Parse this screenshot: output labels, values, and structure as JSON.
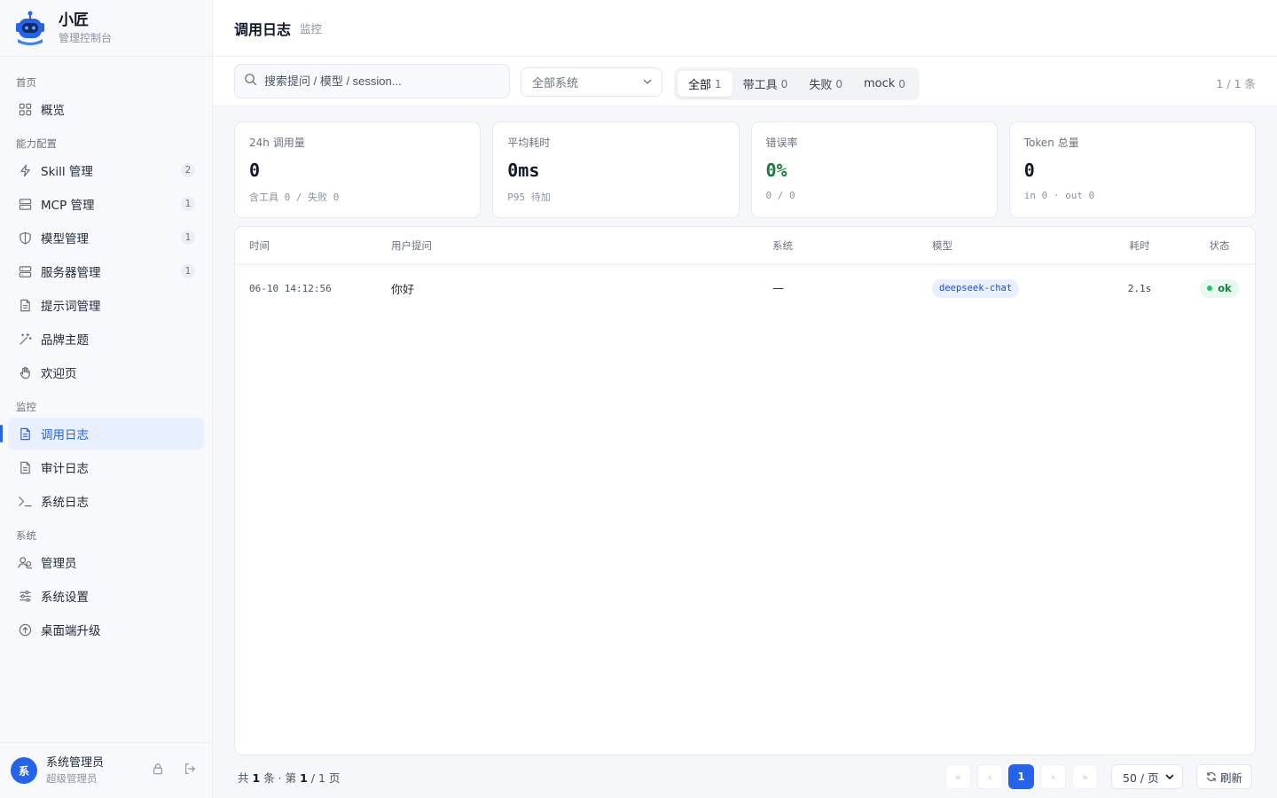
{
  "brand": {
    "title": "小匠",
    "subtitle": "管理控制台"
  },
  "nav": {
    "sections": [
      {
        "label": "首页"
      },
      {
        "label": "能力配置"
      },
      {
        "label": "监控"
      },
      {
        "label": "系统"
      }
    ],
    "items": [
      {
        "label": "概览",
        "icon": "grid-icon"
      },
      {
        "label": "Skill 管理",
        "icon": "lightning-icon",
        "badge": "2"
      },
      {
        "label": "MCP 管理",
        "icon": "server-icon",
        "badge": "1"
      },
      {
        "label": "模型管理",
        "icon": "shield-icon",
        "badge": "1"
      },
      {
        "label": "服务器管理",
        "icon": "server-icon",
        "badge": "1"
      },
      {
        "label": "提示词管理",
        "icon": "document-icon"
      },
      {
        "label": "品牌主题",
        "icon": "magic-wand-icon"
      },
      {
        "label": "欢迎页",
        "icon": "wave-hand-icon"
      },
      {
        "label": "调用日志",
        "icon": "document-icon",
        "active": true
      },
      {
        "label": "审计日志",
        "icon": "document-icon"
      },
      {
        "label": "系统日志",
        "icon": "terminal-icon"
      },
      {
        "label": "管理员",
        "icon": "users-icon"
      },
      {
        "label": "系统设置",
        "icon": "sliders-icon"
      },
      {
        "label": "桌面端升级",
        "icon": "upload-circle-icon"
      }
    ]
  },
  "user": {
    "avatar": "系",
    "name": "系统管理员",
    "role": "超级管理员"
  },
  "header": {
    "title": "调用日志",
    "subtitle": "监控"
  },
  "toolbar": {
    "search_placeholder": "搜索提问 / 模型 / session...",
    "system_select": "全部系统",
    "filters": [
      {
        "label": "全部",
        "count": "1",
        "active": true
      },
      {
        "label": "带工具",
        "count": "0"
      },
      {
        "label": "失败",
        "count": "0"
      },
      {
        "label": "mock",
        "count": "0"
      }
    ],
    "page_summary": "1 / 1 条"
  },
  "stats": [
    {
      "label": "24h 调用量",
      "value": "0",
      "sub": "含工具 0 / 失败 0"
    },
    {
      "label": "平均耗时",
      "value": "0ms",
      "sub": "P95 待加"
    },
    {
      "label": "错误率",
      "value": "0%",
      "sub": "0 / 0",
      "color": "#15803d"
    },
    {
      "label": "Token 总量",
      "value": "0",
      "sub": "in 0 · out 0"
    }
  ],
  "table": {
    "headers": [
      "时间",
      "用户提问",
      "系统",
      "模型",
      "耗时",
      "状态"
    ],
    "rows": [
      {
        "time": "06-10 14:12:56",
        "question": "你好",
        "system": "—",
        "model": "deepseek-chat",
        "duration": "2.1s",
        "status": "ok"
      }
    ]
  },
  "footer": {
    "total_prefix": "共",
    "total": "1",
    "total_unit": "条 · 第",
    "page": "1",
    "page_sep": "/ 1 页",
    "first": "«",
    "prev": "‹",
    "current": "1",
    "next": "›",
    "last": "»",
    "per_page": "50 / 页",
    "refresh": "刷新"
  },
  "colors": {
    "accent": "#2563eb",
    "success": "#15803d",
    "sidebar_bg": "#f8f9fc"
  }
}
